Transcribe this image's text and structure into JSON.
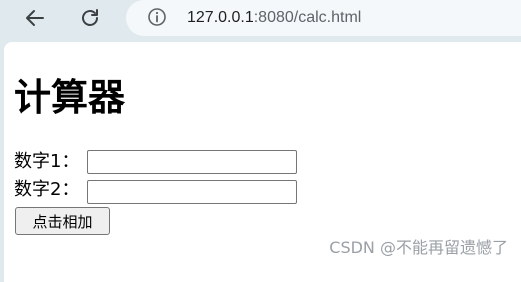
{
  "browser": {
    "url_host": "127.0.0.1",
    "url_rest": ":8080/calc.html",
    "back_icon": "back-arrow-icon",
    "reload_icon": "reload-icon",
    "info_icon": "info-icon"
  },
  "page": {
    "title": "计算器",
    "label1": "数字1：",
    "label2": "数字2：",
    "input1_value": "",
    "input2_value": "",
    "button_label": "点击相加"
  },
  "watermark": "CSDN @不能再留遗憾了"
}
